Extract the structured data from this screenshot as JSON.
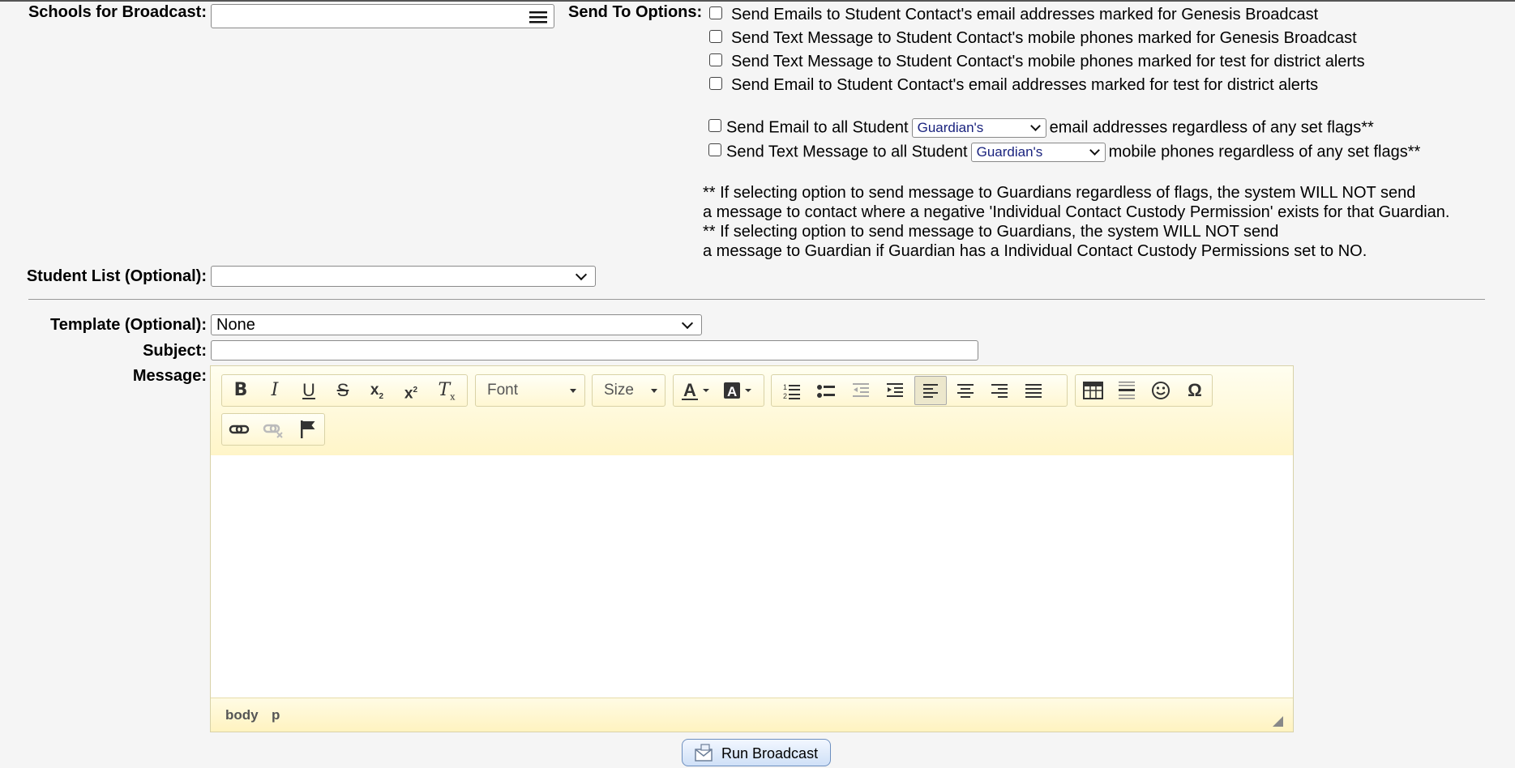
{
  "labels": {
    "schools": "Schools for Broadcast:",
    "send_to": "Send To Options:",
    "student_list": "Student List (Optional):",
    "template": "Template (Optional):",
    "subject": "Subject:",
    "message": "Message:"
  },
  "send_options": [
    "Send Emails to Student Contact's email addresses marked for Genesis Broadcast",
    "Send Text Message to Student Contact's mobile phones marked for Genesis Broadcast",
    "Send Text Message to Student Contact's mobile phones marked for test for district alerts",
    "Send Email to Student Contact's email addresses marked for test for district alerts"
  ],
  "all_email": {
    "prefix": "Send Email to all Student",
    "select": "Guardian's",
    "suffix": "email addresses regardless of any set flags**"
  },
  "all_text": {
    "prefix": "Send Text Message to all Student",
    "select": "Guardian's",
    "suffix": "mobile phones regardless of any set flags**"
  },
  "notes": [
    "** If selecting option to send message to Guardians regardless of flags, the system WILL NOT send",
    "a message to contact where a negative 'Individual Contact Custody Permission' exists for that Guardian.",
    "** If selecting option to send message to Guardians, the system WILL NOT send",
    "a message to Guardian if Guardian has a Individual Contact Custody Permissions set to NO."
  ],
  "template_value": "None",
  "subject_value": "",
  "student_list_value": "",
  "schools_value": "",
  "editor": {
    "font_label": "Font",
    "size_label": "Size",
    "path": [
      "body",
      "p"
    ],
    "icons": [
      "bold-icon",
      "italic-icon",
      "underline-icon",
      "strikethrough-icon",
      "subscript-icon",
      "superscript-icon",
      "remove-format-icon",
      "text-color-icon",
      "background-color-icon",
      "numbered-list-icon",
      "bulleted-list-icon",
      "decrease-indent-icon",
      "increase-indent-icon",
      "align-left-icon",
      "align-center-icon",
      "align-right-icon",
      "justify-icon",
      "table-icon",
      "horizontal-line-icon",
      "smiley-icon",
      "special-char-icon",
      "link-icon",
      "unlink-icon",
      "anchor-icon"
    ]
  },
  "run_button": "Run Broadcast"
}
